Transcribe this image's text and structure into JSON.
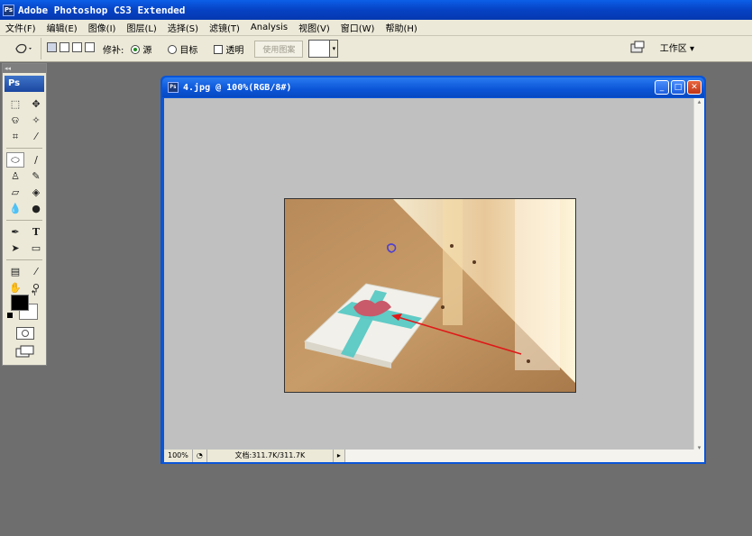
{
  "app": {
    "title": "Adobe Photoshop CS3 Extended"
  },
  "menu": [
    "文件(F)",
    "编辑(E)",
    "图像(I)",
    "图层(L)",
    "选择(S)",
    "滤镜(T)",
    "Analysis",
    "视图(V)",
    "窗口(W)",
    "帮助(H)"
  ],
  "options": {
    "patch_label": "修补:",
    "source_label": "源",
    "target_label": "目标",
    "transparent_label": "透明",
    "use_pattern_label": "使用图案",
    "workspace_label": "工作区 ▾"
  },
  "toolbox": {
    "logo": "Ps"
  },
  "document": {
    "title": "4.jpg @ 100%(RGB/8#)",
    "zoom": "100%",
    "doc_info": "文档:311.7K/311.7K"
  }
}
